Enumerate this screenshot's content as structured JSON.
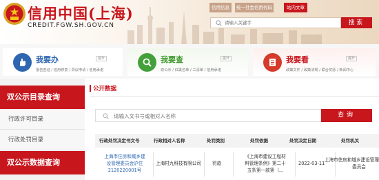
{
  "header": {
    "site_title": "信用中国(上海)",
    "site_url": "CREDIT.FGW.SH.GOV.CN",
    "top_links": [
      "信用信息",
      "统一社会信用代码",
      "站内文章"
    ],
    "search_placeholder": "请输入关键字",
    "search_button": "搜索"
  },
  "cards": [
    {
      "title": "我要办",
      "expand": "展开",
      "sub": "报告查证 / 信用修复 / 异议申请 / 信用承诺"
    },
    {
      "title": "我要查",
      "expand": "展开",
      "sub": "双公示 / 红黑名单 / 三清单 / 信用承诺"
    },
    {
      "title": "我要看",
      "expand": "展开",
      "sub": "政策文件 / 政策法规 / 联合奖惩 / 新闻中心"
    }
  ],
  "sidebar": {
    "heading1": "双公示目录查询",
    "items": [
      "行政许可目录",
      "行政处罚目录"
    ],
    "heading2": "双公示数据查询"
  },
  "main": {
    "section_title": "公开数据",
    "query_placeholder": "请输入文书号或相对人名称",
    "query_button": "查询",
    "columns": [
      "行政处罚决定书文号",
      "行政相对人名称",
      "处罚类别",
      "处罚依据",
      "处罚决定日期",
      "处罚机关"
    ],
    "rows": [
      {
        "doc_no": [
          "上海市住房和城乡建",
          "设管理委员会沪住",
          "2120220001号"
        ],
        "party": "上海村九科技有限公司",
        "category": "罚款",
        "basis": [
          "《上海市建设工程材",
          "料管理条例》第二十",
          "五条第一款第（..."
        ],
        "date": "2022-03-11",
        "authority": [
          "上海市住房和城乡建设管理",
          "委员会"
        ]
      }
    ]
  },
  "colors": {
    "brand_red": "#c8161d",
    "link_blue": "#2e67b0",
    "cha_green": "#43a03a"
  }
}
